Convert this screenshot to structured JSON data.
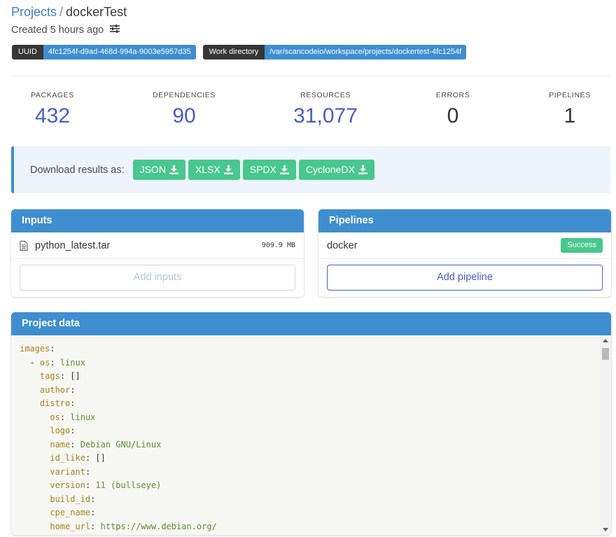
{
  "breadcrumb": {
    "projects": "Projects",
    "separator": "/",
    "current": "dockerTest"
  },
  "created": {
    "text": "Created 5 hours ago",
    "icon": "settings-sliders-icon"
  },
  "tags": {
    "uuid_label": "UUID",
    "uuid_value": "4fc1254f-d9ad-468d-994a-9003e5957d35",
    "workdir_label": "Work directory",
    "workdir_value": "/var/scancodeio/workspace/projects/dockertest-4fc1254f"
  },
  "stats": {
    "packages": {
      "label": "Packages",
      "value": "432"
    },
    "dependencies": {
      "label": "Dependencies",
      "value": "90"
    },
    "resources": {
      "label": "Resources",
      "value": "31,077"
    },
    "errors": {
      "label": "Errors",
      "value": "0"
    },
    "pipelines": {
      "label": "Pipelines",
      "value": "1"
    }
  },
  "download": {
    "label": "Download results as:",
    "buttons": [
      "JSON",
      "XLSX",
      "SPDX",
      "CycloneDX"
    ],
    "icon": "download-icon"
  },
  "inputs": {
    "title": "Inputs",
    "file": {
      "name": "python_latest.tar",
      "size": "909.9 MB",
      "icon": "file-icon"
    },
    "add_button": "Add inputs"
  },
  "pipelines": {
    "title": "Pipelines",
    "item": {
      "name": "docker",
      "status": "Success"
    },
    "add_button": "Add pipeline"
  },
  "project_data": {
    "title": "Project data",
    "lines": [
      {
        "indent": "",
        "key": "images",
        "value": ""
      },
      {
        "indent": "  - ",
        "key": "os",
        "value": "linux"
      },
      {
        "indent": "    ",
        "key": "tags",
        "value": "[]"
      },
      {
        "indent": "    ",
        "key": "author",
        "value": ""
      },
      {
        "indent": "    ",
        "key": "distro",
        "value": ""
      },
      {
        "indent": "      ",
        "key": "os",
        "value": "linux"
      },
      {
        "indent": "      ",
        "key": "logo",
        "value": ""
      },
      {
        "indent": "      ",
        "key": "name",
        "value": "Debian GNU/Linux"
      },
      {
        "indent": "      ",
        "key": "id_like",
        "value": "[]"
      },
      {
        "indent": "      ",
        "key": "variant",
        "value": ""
      },
      {
        "indent": "      ",
        "key": "version",
        "value": "11 (bullseye)"
      },
      {
        "indent": "      ",
        "key": "build_id",
        "value": ""
      },
      {
        "indent": "      ",
        "key": "cpe_name",
        "value": ""
      },
      {
        "indent": "      ",
        "key": "home_url",
        "value": "https://www.debian.org/"
      }
    ]
  },
  "colors": {
    "primary": "#3e8ed0",
    "link": "#485fc7",
    "success": "#48c78e",
    "dark": "#363636"
  }
}
